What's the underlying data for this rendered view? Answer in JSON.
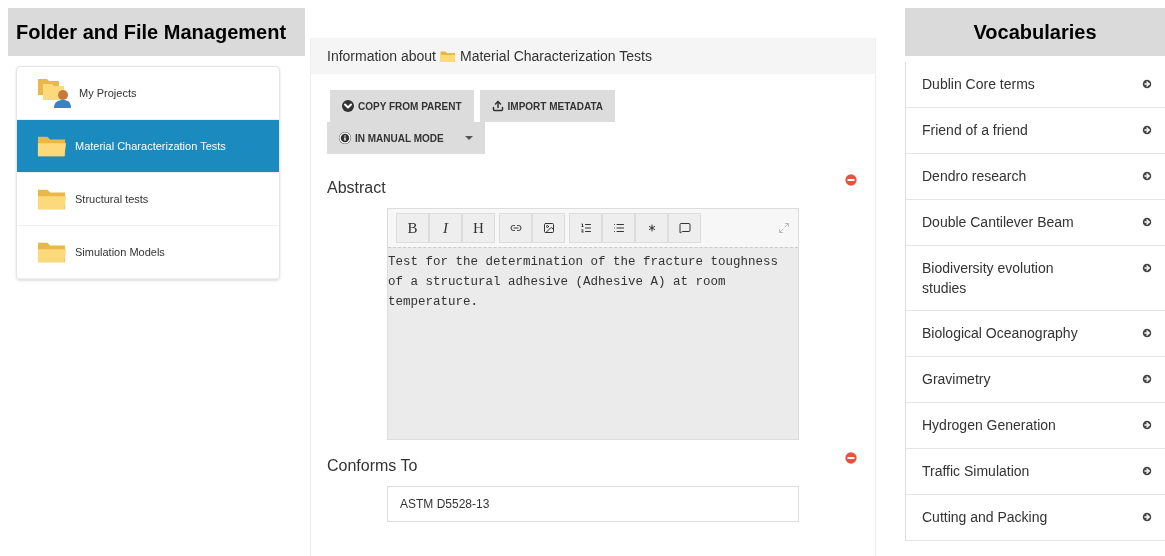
{
  "folders": {
    "title": "Folder and File Management",
    "items": [
      {
        "label": "My Projects",
        "kind": "projects",
        "selected": false
      },
      {
        "label": "Material Characterization Tests",
        "kind": "folder",
        "selected": true
      },
      {
        "label": "Structural tests",
        "kind": "folder",
        "selected": false
      },
      {
        "label": "Simulation Models",
        "kind": "folder",
        "selected": false
      }
    ]
  },
  "info": {
    "prefix": "Information about",
    "folder": "Material Characterization Tests",
    "buttons": [
      {
        "label": "COPY FROM PARENT",
        "kind": "copy"
      },
      {
        "label": "IMPORT METADATA",
        "kind": "import"
      }
    ],
    "mode": {
      "label": "IN MANUAL MODE"
    },
    "fields": [
      {
        "label": "Abstract",
        "kind": "editor",
        "toolbar": [
          [
            {
              "kind": "bold",
              "label": "B"
            },
            {
              "kind": "italic",
              "label": "I"
            },
            {
              "kind": "heading",
              "label": "H"
            }
          ],
          [
            {
              "kind": "link"
            },
            {
              "kind": "image"
            }
          ],
          [
            {
              "kind": "ordered-list"
            },
            {
              "kind": "list"
            },
            {
              "kind": "asterisk"
            },
            {
              "kind": "comment"
            }
          ]
        ],
        "value": "Test for the determination of the fracture toughness of a structural adhesive (Adhesive A) at room temperature."
      },
      {
        "label": "Conforms To",
        "kind": "text",
        "value": "ASTM D5528-13"
      }
    ]
  },
  "vocabularies": {
    "title": "Vocabularies",
    "items": [
      "Dublin Core terms",
      "Friend of a friend",
      "Dendro research",
      "Double Cantilever Beam",
      "Biodiversity evolution studies",
      "Biological Oceanography",
      "Gravimetry",
      "Hydrogen Generation",
      "Traffic Simulation",
      "Cutting and Packing"
    ]
  }
}
